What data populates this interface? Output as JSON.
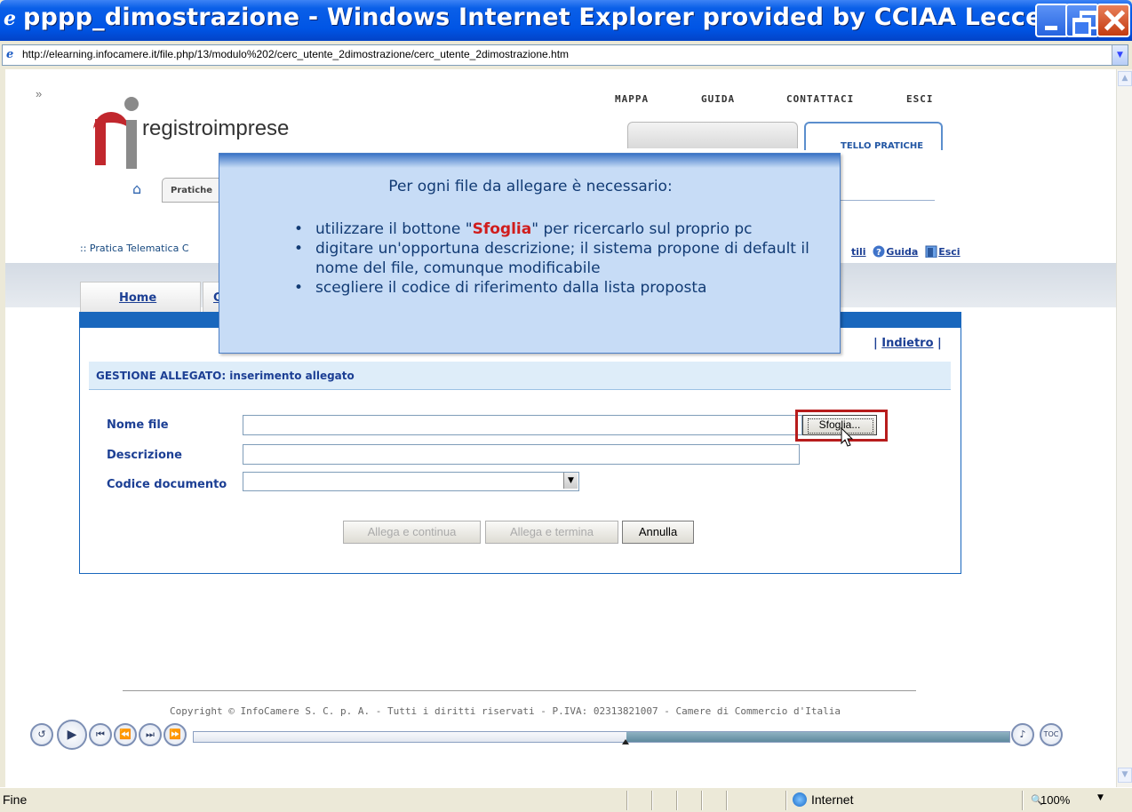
{
  "window": {
    "title": "pppp_dimostrazione - Windows Internet Explorer provided by CCIAA Lecce"
  },
  "address": {
    "url": "http://elearning.infocamere.it/file.php/13/modulo%202/cerc_utente_2dimostrazione/cerc_utente_2dimostrazione.htm"
  },
  "page": {
    "collapse_glyph": "»",
    "top_links": [
      "MAPPA",
      "GUIDA",
      "CONTATTACI",
      "ESCI"
    ],
    "logo_text": "registroimprese",
    "tab_sportello": "TELLO PRATICHE",
    "pratiche_tab": "Pratiche",
    "breadcrumb": ":: Pratica Telematica C",
    "right_links": {
      "utili": "tili",
      "guida": "Guida",
      "esci": "Esci"
    },
    "home_tab": "Home",
    "tab2_char": "C",
    "indietro": "Indietro",
    "section_title": "GESTIONE ALLEGATO: inserimento allegato",
    "form": {
      "nome_file_label": "Nome file",
      "descrizione_label": "Descrizione",
      "codice_label": "Codice documento",
      "nome_file_value": "",
      "descrizione_value": "",
      "codice_value": "",
      "sfoglia_label": "Sfoglia..."
    },
    "buttons": {
      "allega_continua": "Allega e continua",
      "allega_termina": "Allega e termina",
      "annulla": "Annulla"
    },
    "copyright": "Copyright © InfoCamere S. C. p. A. - Tutti i diritti riservati - P.IVA: 02313821007 - Camere di Commercio d'Italia"
  },
  "tooltip": {
    "title": "Per ogni file da allegare è necessario:",
    "items": [
      {
        "before": "utilizzare il bottone \"",
        "highlight": "Sfoglia",
        "after": "\" per ricercarlo sul proprio pc"
      },
      {
        "before": "digitare un'opportuna descrizione; il sistema propone di default il nome del file, comunque modificabile",
        "highlight": "",
        "after": ""
      },
      {
        "before": "scegliere il codice di riferimento dalla lista proposta",
        "highlight": "",
        "after": ""
      }
    ]
  },
  "player": {
    "progress": 0.53
  },
  "statusbar": {
    "status": "Fine",
    "zone": "Internet",
    "zoom": "100%"
  },
  "colors": {
    "titlebar": "#0055e5",
    "accent_blue": "#1967bd",
    "highlight_red": "#b71c1c"
  }
}
